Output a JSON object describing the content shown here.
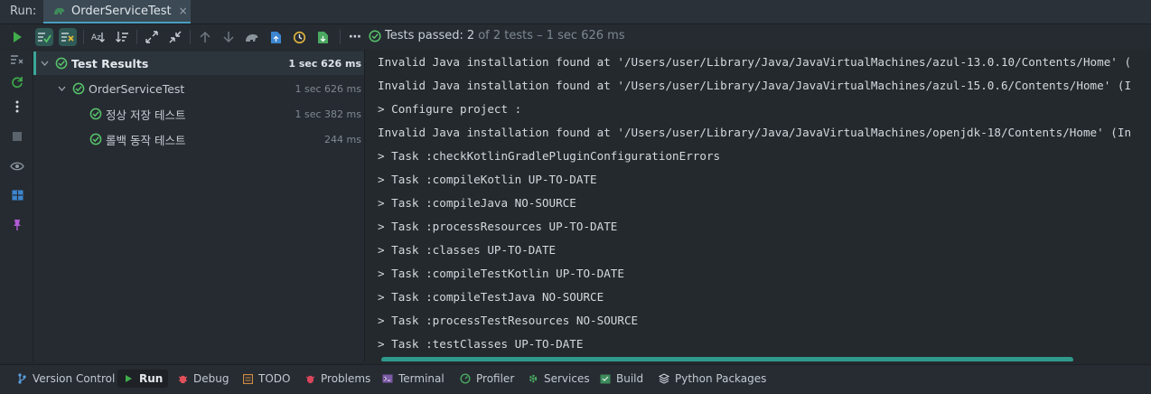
{
  "header": {
    "run_label": "Run:",
    "tab_title": "OrderServiceTest",
    "tab_close": "×"
  },
  "toolbar": {
    "status_prefix": "Tests passed:",
    "status_count": "2",
    "status_rest": "of 2 tests – 1 sec 626 ms",
    "more_glyph": "⋯"
  },
  "tree": {
    "rows": [
      {
        "label": "Test Results",
        "duration": "1 sec 626 ms"
      },
      {
        "label": "OrderServiceTest",
        "duration": "1 sec 626 ms"
      },
      {
        "label": "정상 저장 테스트",
        "duration": "1 sec 382 ms"
      },
      {
        "label": "롤백 동작 테스트",
        "duration": "244 ms"
      }
    ]
  },
  "console": {
    "lines": [
      "Invalid Java installation found at '/Users/user/Library/Java/JavaVirtualMachines/azul-13.0.10/Contents/Home' (",
      "Invalid Java installation found at '/Users/user/Library/Java/JavaVirtualMachines/azul-15.0.6/Contents/Home' (I",
      "> Configure project :",
      "Invalid Java installation found at '/Users/user/Library/Java/JavaVirtualMachines/openjdk-18/Contents/Home' (In",
      "> Task :checkKotlinGradlePluginConfigurationErrors",
      "> Task :compileKotlin UP-TO-DATE",
      "> Task :compileJava NO-SOURCE",
      "> Task :processResources UP-TO-DATE",
      "> Task :classes UP-TO-DATE",
      "> Task :compileTestKotlin UP-TO-DATE",
      "> Task :compileTestJava NO-SOURCE",
      "> Task :processTestResources NO-SOURCE",
      "> Task :testClasses UP-TO-DATE"
    ]
  },
  "bottom_tabs": [
    {
      "label": "Version Control",
      "icon": "branch-icon"
    },
    {
      "label": "Run",
      "icon": "run-icon"
    },
    {
      "label": "Debug",
      "icon": "bug-icon"
    },
    {
      "label": "TODO",
      "icon": "todo-icon"
    },
    {
      "label": "Problems",
      "icon": "problems-icon"
    },
    {
      "label": "Terminal",
      "icon": "terminal-icon"
    },
    {
      "label": "Profiler",
      "icon": "profiler-icon"
    },
    {
      "label": "Services",
      "icon": "services-icon"
    },
    {
      "label": "Build",
      "icon": "build-icon"
    },
    {
      "label": "Python Packages",
      "icon": "packages-icon"
    }
  ],
  "colors": {
    "accent_green": "#3fae4b",
    "accent_teal": "#2f9a8c",
    "background": "#24292e"
  }
}
